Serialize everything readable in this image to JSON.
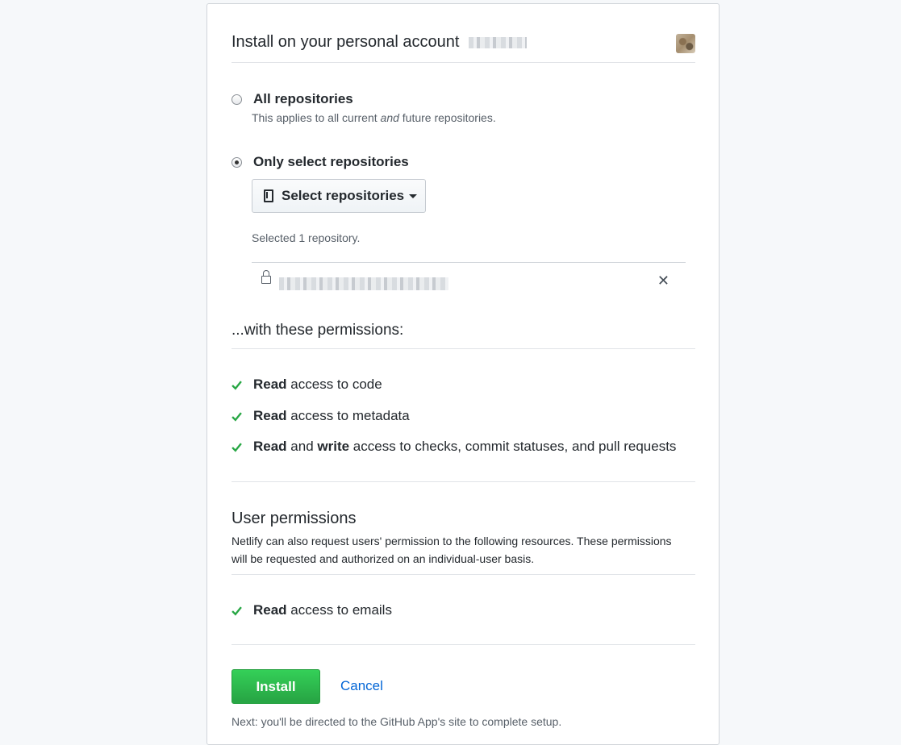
{
  "header": {
    "title": "Install on your personal account",
    "account_name_redacted": true
  },
  "repository_scope": {
    "options": [
      {
        "label": "All repositories",
        "note_prefix": "This applies to all current ",
        "note_emphasis": "and",
        "note_suffix": " future repositories.",
        "selected": false
      },
      {
        "label": "Only select repositories",
        "selected": true
      }
    ],
    "select_button_label": "Select repositories",
    "selected_count_text": "Selected 1 repository.",
    "selected_repo": {
      "private": true,
      "name_redacted": true,
      "remove_glyph": "✕"
    }
  },
  "permissions": {
    "heading": "...with these permissions:",
    "items": [
      {
        "bold1": "Read",
        "middle": "",
        "bold2": "",
        "rest": " access to code"
      },
      {
        "bold1": "Read",
        "middle": "",
        "bold2": "",
        "rest": " access to metadata"
      },
      {
        "bold1": "Read",
        "middle": " and ",
        "bold2": "write",
        "rest": " access to checks, commit statuses, and pull requests"
      }
    ]
  },
  "user_permissions": {
    "heading": "User permissions",
    "description": "Netlify can also request users' permission to the following resources. These permissions will be requested and authorized on an individual-user basis.",
    "items": [
      {
        "bold1": "Read",
        "rest": " access to emails"
      }
    ]
  },
  "actions": {
    "install_label": "Install",
    "cancel_label": "Cancel",
    "next_note": "Next: you'll be directed to the GitHub App's site to complete setup."
  },
  "colors": {
    "check": "#28a745",
    "link": "#0366d6",
    "install_button": "#2cbe4e"
  }
}
